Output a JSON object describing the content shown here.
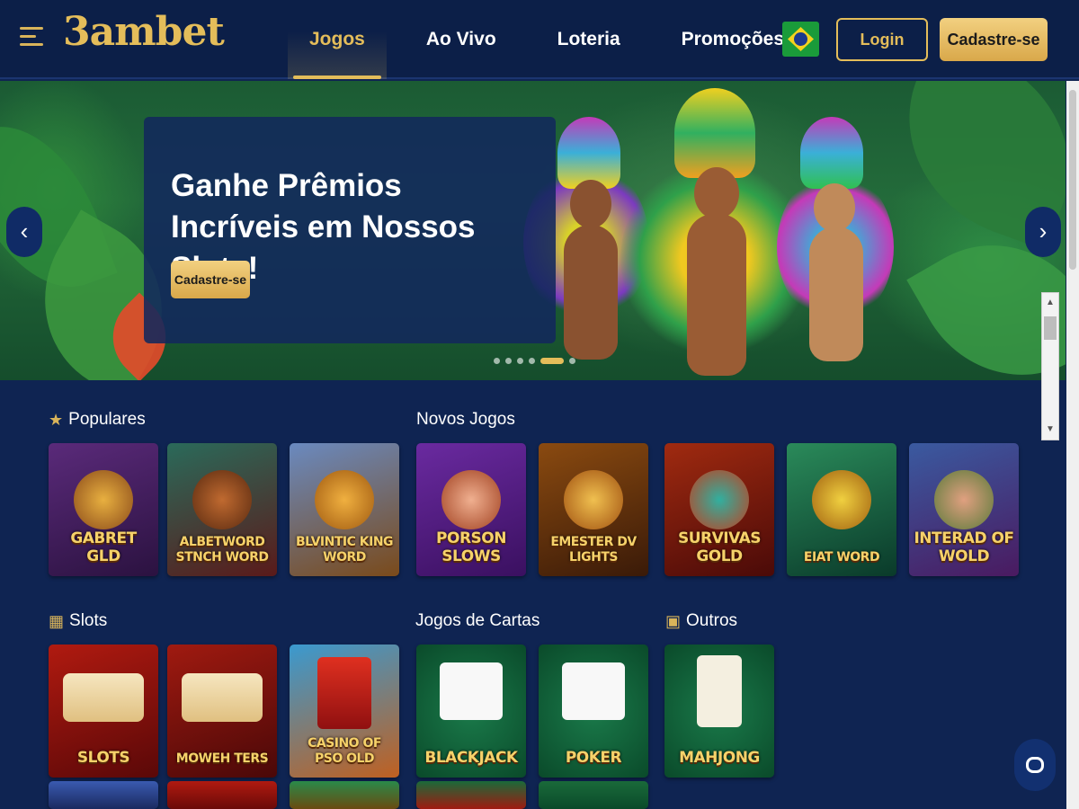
{
  "header": {
    "logo": "3ambet",
    "nav": [
      "Jogos",
      "Ao Vivo",
      "Loteria",
      "Promoções"
    ],
    "active_nav": "Jogos",
    "login_label": "Login",
    "signup_label": "Cadastre-se",
    "flag_icon": "brazil-flag-icon",
    "menu_icon": "hamburger-menu-icon"
  },
  "banner": {
    "title": "Ganhe Prêmios Incríveis em Nossos Slots!",
    "cta_label": "Cadastre-se",
    "prev_icon": "chevron-left-icon",
    "next_icon": "chevron-right-icon",
    "slide_count": 6,
    "active_slide": 5
  },
  "sections": {
    "populares": {
      "title": "Populares",
      "icon": "star-icon",
      "games": [
        "GABRET GLD",
        "ALBETWORD STNCH WORD",
        "BLVINTIC KING WORD"
      ]
    },
    "novos_jogos": {
      "title": "Novos Jogos",
      "games": [
        "PORSON SLOWS",
        "EMESTER DV LIGHTS",
        "SURVIVAS GOLD",
        "EIAT WORD",
        "INTERAD OF WOLD"
      ]
    },
    "slots": {
      "title": "Slots",
      "icon": "slot-machine-icon",
      "games": [
        "SLOTS",
        "MOWEH TERS",
        "CASINO OF PSO OLD"
      ]
    },
    "jogos_de_cartas": {
      "title": "Jogos de Cartas",
      "games": [
        "BLACKJACK",
        "POKER"
      ]
    },
    "outros": {
      "title": "Outros",
      "icon": "blocks-icon",
      "games": [
        "MAHJONG"
      ]
    }
  },
  "chat_icon": "chat-bubble-icon",
  "colors": {
    "background": "#0f2452",
    "header": "#0c1f48",
    "accent_gold": "#e4bd5a"
  }
}
